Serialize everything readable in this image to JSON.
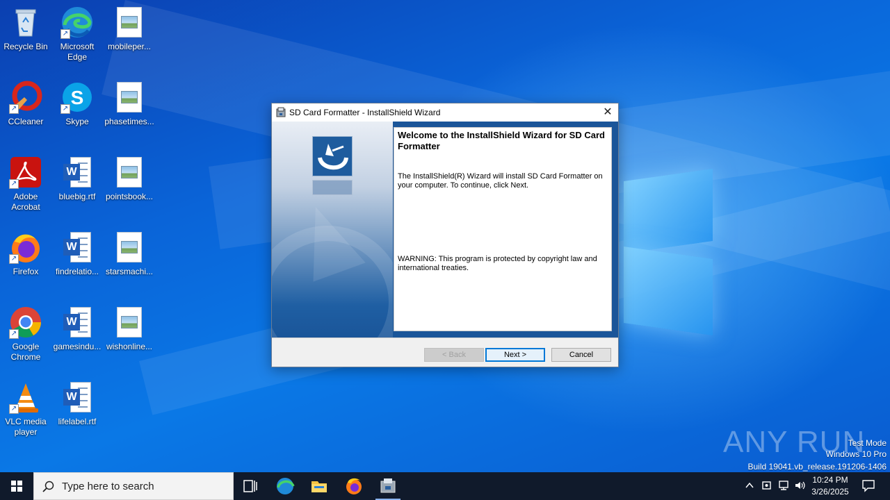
{
  "desktop": {
    "icons": [
      {
        "label": "Recycle Bin",
        "icon": "recycle-bin-icon"
      },
      {
        "label": "Microsoft Edge",
        "icon": "edge-icon"
      },
      {
        "label": "mobileper...",
        "icon": "image-file-icon"
      },
      {
        "label": "CCleaner",
        "icon": "ccleaner-icon"
      },
      {
        "label": "Skype",
        "icon": "skype-icon"
      },
      {
        "label": "phasetimes...",
        "icon": "image-file-icon"
      },
      {
        "label": "Adobe Acrobat",
        "icon": "acrobat-icon"
      },
      {
        "label": "bluebig.rtf",
        "icon": "word-doc-icon"
      },
      {
        "label": "pointsbook...",
        "icon": "image-file-icon"
      },
      {
        "label": "Firefox",
        "icon": "firefox-icon"
      },
      {
        "label": "findrelatio...",
        "icon": "word-doc-icon"
      },
      {
        "label": "starsmachi...",
        "icon": "image-file-icon"
      },
      {
        "label": "Google Chrome",
        "icon": "chrome-icon"
      },
      {
        "label": "gamesindu...",
        "icon": "word-doc-icon"
      },
      {
        "label": "wishonline...",
        "icon": "image-file-icon"
      },
      {
        "label": "VLC media player",
        "icon": "vlc-icon"
      },
      {
        "label": "lifelabel.rtf",
        "icon": "word-doc-icon"
      }
    ]
  },
  "wizard": {
    "title": "SD Card Formatter - InstallShield Wizard",
    "heading": "Welcome to the InstallShield Wizard for SD Card Formatter",
    "body": "The InstallShield(R) Wizard will install SD Card Formatter on your computer. To continue, click Next.",
    "warning": "WARNING: This program is protected by copyright law and international treaties.",
    "buttons": {
      "back": "< Back",
      "next": "Next >",
      "cancel": "Cancel"
    },
    "close_glyph": "✕"
  },
  "watermark": {
    "brand": "ANY RUN",
    "mode": "Test Mode",
    "edition": "Windows 10 Pro",
    "build": "Build 19041.vb_release.191206-1406"
  },
  "taskbar": {
    "search_placeholder": "Type here to search",
    "time": "10:24 PM",
    "date": "3/26/2025"
  },
  "colors": {
    "accent": "#0078d7",
    "taskbar": "#101a2b",
    "wizard_blue": "#1a5599"
  }
}
